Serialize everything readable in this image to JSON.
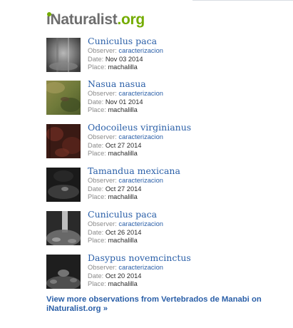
{
  "logo": {
    "i": "i",
    "naturalist": "Naturalist",
    "org": ".org"
  },
  "labels": {
    "observer": "Observer:",
    "date": "Date:",
    "place": "Place:"
  },
  "observations": [
    {
      "species": "Cuniculus paca",
      "observer": "caracterizacion",
      "date": "Nov 03 2014",
      "place": "machalilla"
    },
    {
      "species": "Nasua nasua",
      "observer": "caracterizacion",
      "date": "Nov 01 2014",
      "place": "machalilla"
    },
    {
      "species": "Odocoileus virginianus",
      "observer": "caracterizacion",
      "date": "Oct 27 2014",
      "place": "machalilla"
    },
    {
      "species": "Tamandua mexicana",
      "observer": "caracterizacion",
      "date": "Oct 27 2014",
      "place": "machalilla"
    },
    {
      "species": "Cuniculus paca",
      "observer": "caracterizacion",
      "date": "Oct 26 2014",
      "place": "machalilla"
    },
    {
      "species": "Dasypus novemcinctus",
      "observer": "caracterizacion",
      "date": "Oct 20 2014",
      "place": "machalilla"
    }
  ],
  "footer": {
    "link_text": "View more observations from Vertebrados de Manabi on iNaturalist.org »"
  },
  "colors": {
    "link": "#2a5fa8",
    "brand_green": "#74ac00",
    "brand_gray": "#6d6d6d"
  }
}
